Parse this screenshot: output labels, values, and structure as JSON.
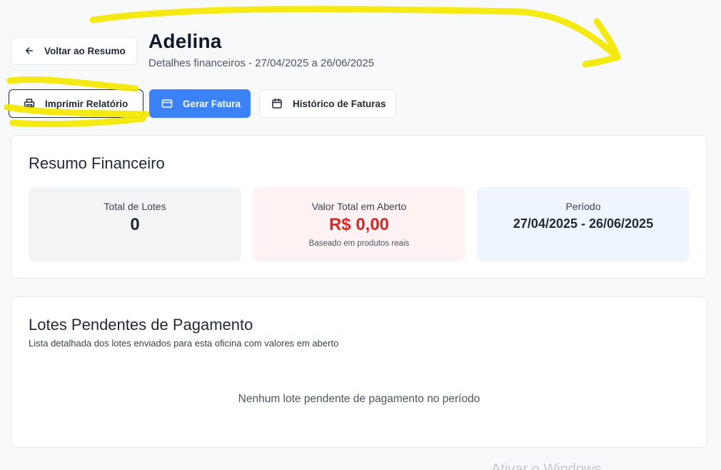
{
  "header": {
    "back_label": "Voltar ao Resumo",
    "title": "Adelina",
    "subtitle": "Detalhes financeiros - 27/04/2025 a 26/06/2025"
  },
  "actions": {
    "print_label": "Imprimir Relatório",
    "invoice_label": "Gerar Fatura",
    "history_label": "Histórico de Faturas"
  },
  "summary": {
    "title": "Resumo Financeiro",
    "stats": [
      {
        "label": "Total de Lotes",
        "value": "0"
      },
      {
        "label": "Valor Total em Aberto",
        "value": "R$ 0,00",
        "note": "Baseado em produtos reais"
      },
      {
        "label": "Período",
        "value": "27/04/2025 - 26/06/2025"
      }
    ]
  },
  "lots": {
    "title": "Lotes Pendentes de Pagamento",
    "description": "Lista detalhada dos lotes enviados para esta oficina com valores em aberto",
    "empty_message": "Nenhum lote pendente de pagamento no período"
  },
  "overlay": {
    "watermark": "Ativar o Windows"
  },
  "colors": {
    "primary": "#3b82f6",
    "danger": "#dc2626",
    "highlight": "#f5e800"
  },
  "icons": [
    "arrow-left-icon",
    "printer-icon",
    "credit-card-icon",
    "calendar-icon"
  ]
}
